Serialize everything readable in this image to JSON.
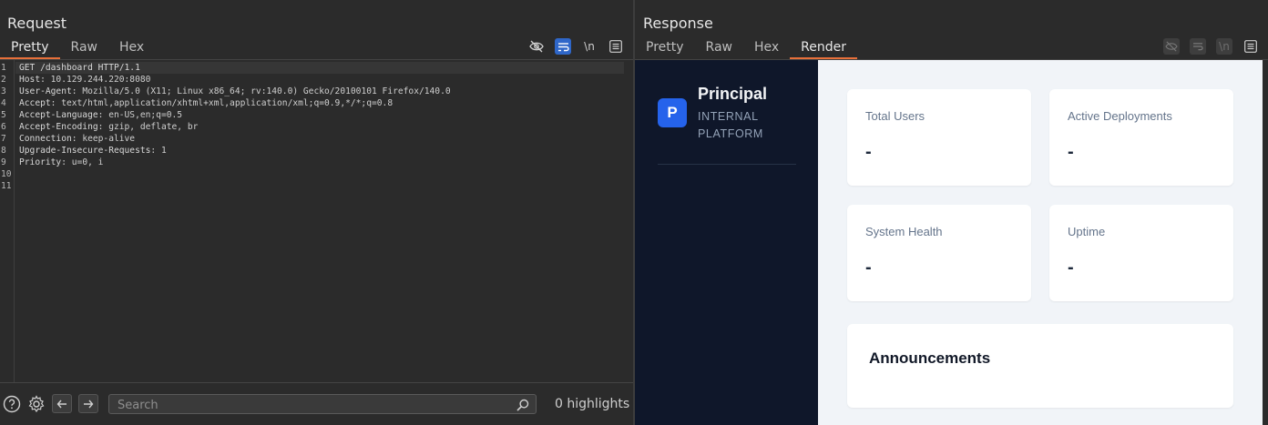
{
  "request": {
    "title": "Request",
    "tabs": [
      "Pretty",
      "Raw",
      "Hex"
    ],
    "active_tab": "Pretty",
    "tools": [
      "eye-off-icon",
      "wrap-icon",
      "newline-toggle",
      "menu-icon"
    ],
    "newline_label": "\\n",
    "lines": [
      {
        "n": "1",
        "k": "GET /dashboard HTTP/1.1",
        "v": ""
      },
      {
        "n": "2",
        "k": "Host",
        "v": ": 10.129.244.220:8080"
      },
      {
        "n": "3",
        "k": "User-Agent",
        "v": ": Mozilla/5.0 (X11; Linux x86_64; rv:140.0) Gecko/20100101 Firefox/140.0"
      },
      {
        "n": "4",
        "k": "Accept",
        "v": ": text/html,application/xhtml+xml,application/xml;q=0.9,*/*;q=0.8"
      },
      {
        "n": "5",
        "k": "Accept-Language",
        "v": ": en-US,en;q=0.5"
      },
      {
        "n": "6",
        "k": "Accept-Encoding",
        "v": ": gzip, deflate, br"
      },
      {
        "n": "7",
        "k": "Connection",
        "v": ": keep-alive"
      },
      {
        "n": "8",
        "k": "Upgrade-Insecure-Requests",
        "v": ": 1"
      },
      {
        "n": "9",
        "k": "Priority",
        "v": ": u=0, i"
      },
      {
        "n": "10",
        "k": "",
        "v": ""
      },
      {
        "n": "11",
        "k": "",
        "v": ""
      }
    ],
    "search_placeholder": "Search",
    "highlights": "0 highlights"
  },
  "response": {
    "title": "Response",
    "tabs": [
      "Pretty",
      "Raw",
      "Hex",
      "Render"
    ],
    "active_tab": "Render",
    "newline_label": "\\n",
    "page": {
      "logo_letter": "P",
      "brand": "Principal",
      "brand_sub": "INTERNAL PLATFORM",
      "cards": [
        {
          "label": "Total Users",
          "value": "-"
        },
        {
          "label": "Active Deployments",
          "value": "-"
        },
        {
          "label": "System Health",
          "value": "-"
        },
        {
          "label": "Uptime",
          "value": "-"
        }
      ],
      "announcements_title": "Announcements"
    }
  },
  "colors": {
    "accent_tab": "#e8703a",
    "tool_active": "#2f67c9",
    "brand_blue": "#2563eb",
    "sidebar_bg": "#0f172a"
  }
}
